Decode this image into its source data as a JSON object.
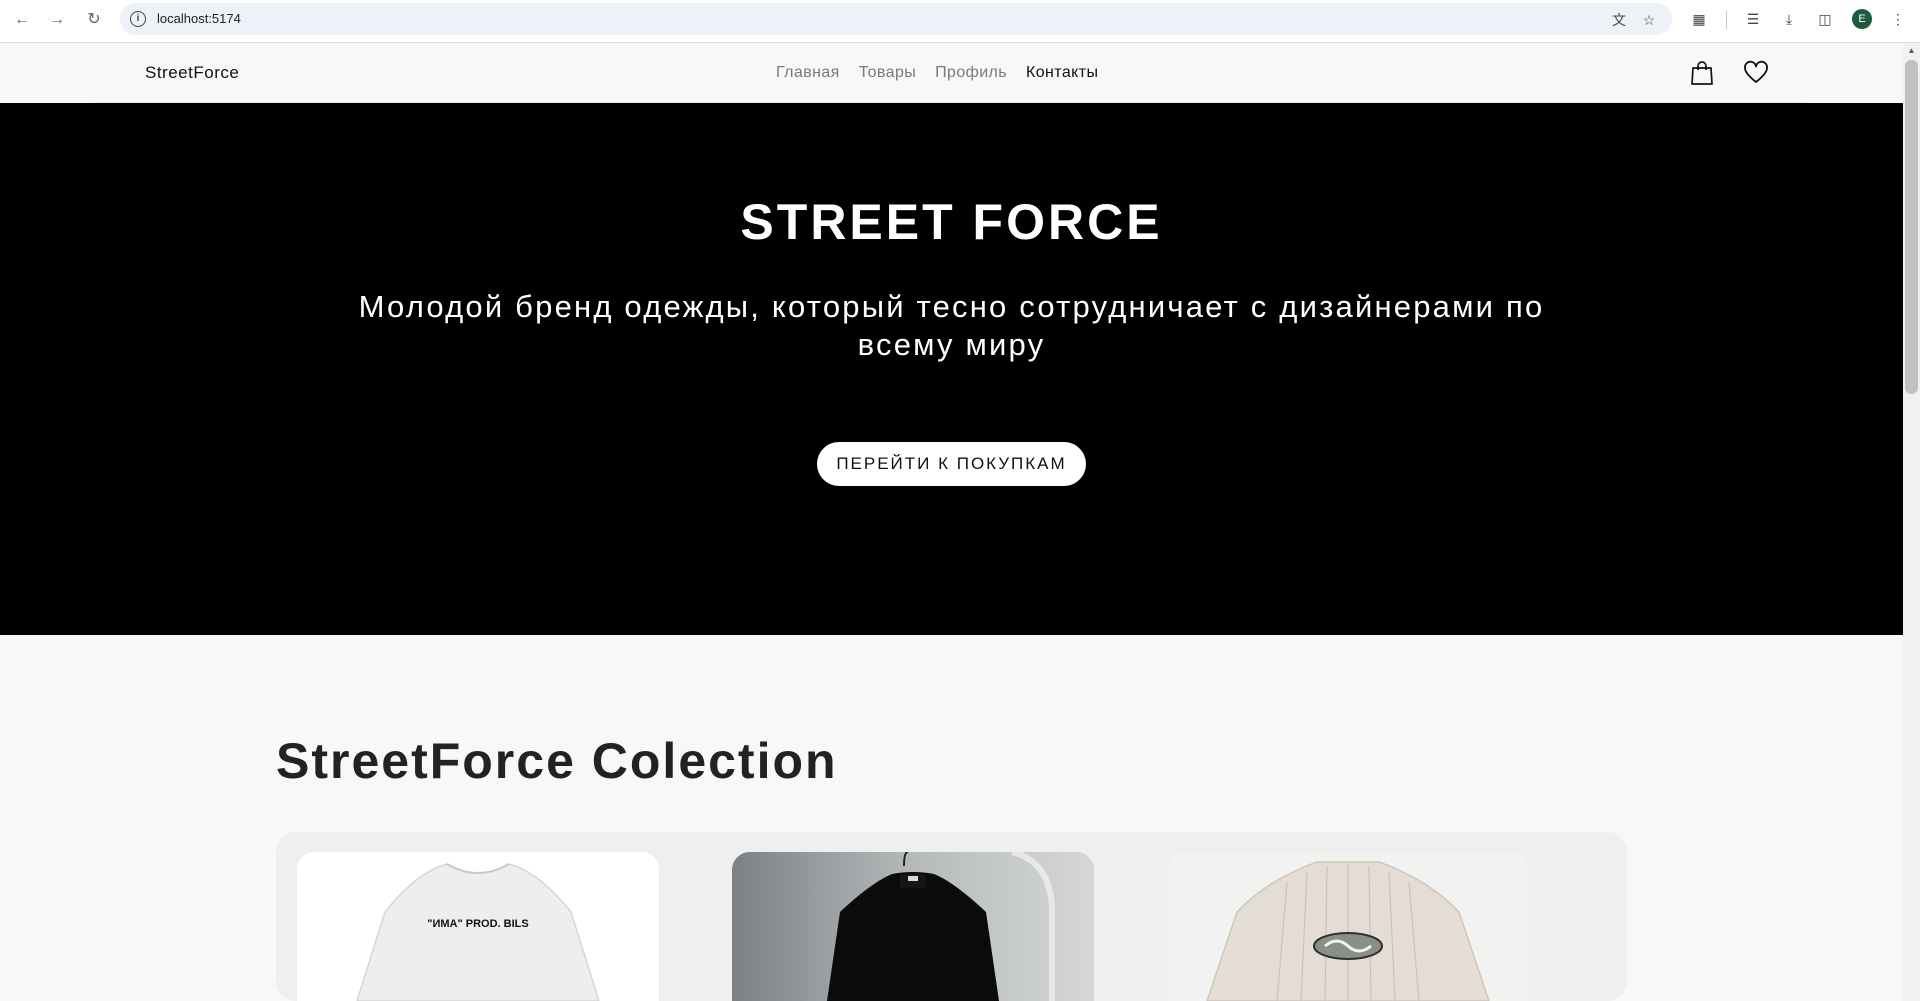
{
  "browser": {
    "url": "localhost:5174",
    "profile_initial": "E"
  },
  "site": {
    "logo": "StreetForce",
    "nav": [
      {
        "label": "Главная",
        "active": false
      },
      {
        "label": "Товары",
        "active": false
      },
      {
        "label": "Профиль",
        "active": false
      },
      {
        "label": "Контакты",
        "active": true
      }
    ],
    "icons": [
      "shopping-bag-icon",
      "heart-icon"
    ]
  },
  "hero": {
    "title": "STREET FORCE",
    "subtitle": "Молодой бренд одежды, который тесно сотрудничает с дизайнерами по всему миру",
    "cta_label": "ПЕРЕЙТИ К ПОКУПКАМ"
  },
  "collection": {
    "title": "StreetForce Colection",
    "products": [
      {
        "name": "white-longsleeve",
        "print_text": "\"ИМА\" PROD. BILS"
      },
      {
        "name": "black-zip-jacket"
      },
      {
        "name": "cream-puffer-jacket"
      }
    ]
  },
  "colors": {
    "hero_bg": "#000000",
    "page_bg": "#f8f8f8",
    "nav_inactive": "#7a7a7a",
    "nav_active": "#111111"
  }
}
